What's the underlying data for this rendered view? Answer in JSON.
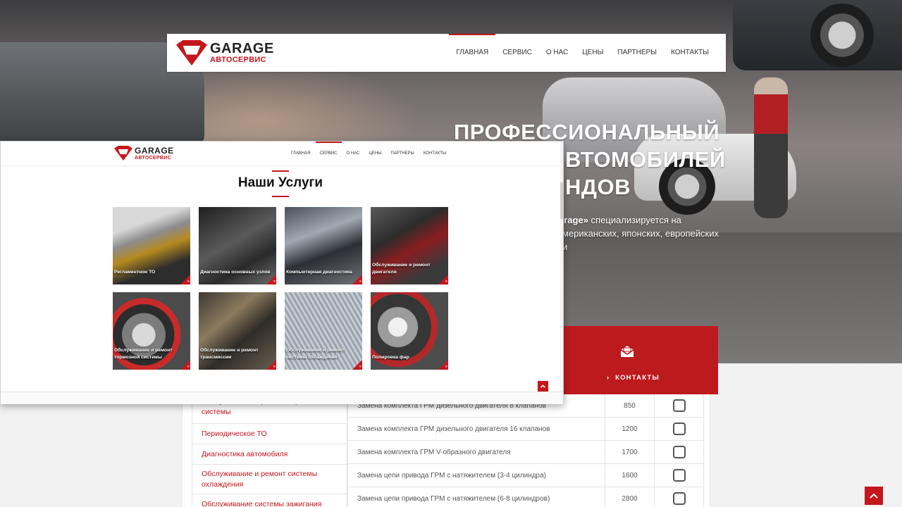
{
  "brand": {
    "name": "GARAGE",
    "subtitle": "АВТОСЕРВИС"
  },
  "colors": {
    "accent": "#c4171d",
    "dark_text": "#222222",
    "muted_text": "#555555"
  },
  "nav": {
    "items": [
      "ГЛАВНАЯ",
      "СЕРВИС",
      "О НАС",
      "ЦЕНЫ",
      "ПАРТНЕРЫ",
      "КОНТАКТЫ"
    ],
    "active": "ГЛАВНАЯ"
  },
  "hero": {
    "title_lines": [
      "ПРОФЕССИОНАЛЬНЫЙ",
      "ВТОМОБИЛЕЙ",
      "НДОВ"
    ],
    "text_brand": "arage»",
    "text_line1": " специализируется на",
    "text_line2": "мериканских, японских, европейских и"
  },
  "contacts_box": {
    "label": "КОНТАКТЫ",
    "icon": "envelope-open-icon",
    "chevron": "›"
  },
  "overlay": {
    "nav_items": [
      "ГЛАВНАЯ",
      "СЕРВИС",
      "О НАС",
      "ЦЕНЫ",
      "ПАРТНЕРЫ",
      "КОНТАКТЫ"
    ],
    "active": "СЕРВИС",
    "section_title": "Наши Услуги",
    "services": [
      "Регламентное ТО",
      "Диагностика основных узлов",
      "Компьютерная диагностика",
      "Обслуживание и ремонт двигателя",
      "Обслуживание и ремонт тормозной системы",
      "Обслуживание и ремонт трансмиссии",
      "Обслуживание и ремонт системы охлаждения",
      "Полировка фар"
    ],
    "tile_arrow": "»"
  },
  "prices": {
    "categories": [
      "Обслуживание и ремонт тормозной системы",
      "Периодическое ТО",
      "Диагностика автомобиля",
      "Обслуживание и ремонт системы охлаждения",
      "Обслуживание системы зажигания"
    ],
    "rows": [
      {
        "name": "Замена комплекта ГРМ дизельного двигателя 8 клапанов",
        "price": "850"
      },
      {
        "name": "Замена комплекта ГРМ дизельного двигателя 16 клапанов",
        "price": "1200"
      },
      {
        "name": "Замена комплекта ГРМ V-образного двигателя",
        "price": "1700"
      },
      {
        "name": "Замена цепи привода ГРМ с натяжителем (3-4 цилиндра)",
        "price": "1600"
      },
      {
        "name": "Замена цепи привода ГРМ с натяжителем (6-8 цилиндров)",
        "price": "2800"
      }
    ]
  }
}
